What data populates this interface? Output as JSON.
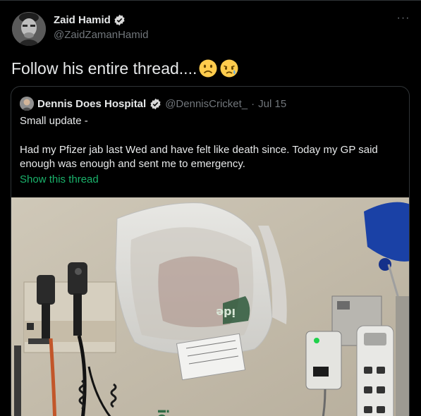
{
  "author": {
    "name": "Zaid Hamid",
    "handle": "@ZaidZamanHamid",
    "verified_icon": "verified-badge-icon",
    "more_label": "···"
  },
  "tweet": {
    "text": "Follow his entire thread....",
    "emojis": [
      "slightly-frowning-face-emoji",
      "crying-face-emoji"
    ]
  },
  "quoted": {
    "name": "Dennis Does Hospital",
    "handle": "@DennisCricket_",
    "separator": "·",
    "date": "Jul 15",
    "line1": "Small update -",
    "line2": "Had my Pfizer jab last Wed and have felt like death since. Today my GP said enough was enough and sent me to emergency.",
    "show_thread": "Show this thread",
    "media_text": [
      "ide",
      "ide"
    ]
  },
  "colors": {
    "background": "#000000",
    "text": "#e7e9ea",
    "muted": "#71767b",
    "verified": "#d9d9d9",
    "link": "#1ab26b",
    "border": "#2f3336"
  }
}
